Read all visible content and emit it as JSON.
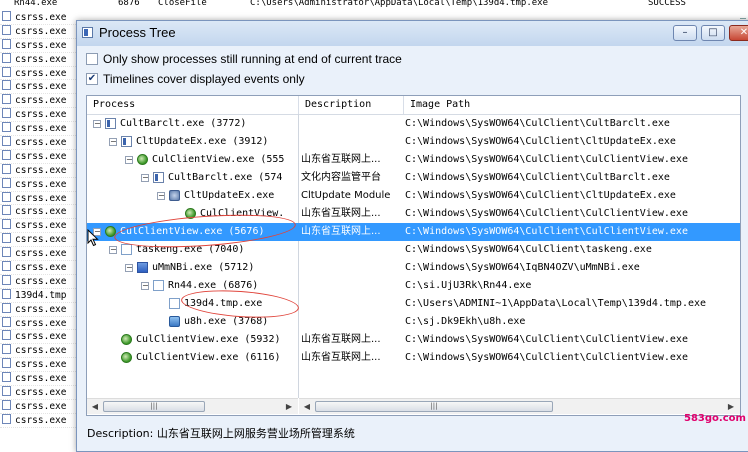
{
  "background": {
    "top_row": {
      "col1": "Rn44.exe",
      "pid": "6876",
      "operation": "CloseFile",
      "path": "C:\\Users\\Administrator\\AppData\\Local\\Temp\\139d4.tmp.exe",
      "result": "SUCCESS"
    },
    "rows": [
      "csrss.exe",
      "csrss.exe",
      "csrss.exe",
      "csrss.exe",
      "csrss.exe",
      "csrss.exe",
      "csrss.exe",
      "csrss.exe",
      "csrss.exe",
      "csrss.exe",
      "csrss.exe",
      "csrss.exe",
      "csrss.exe",
      "csrss.exe",
      "csrss.exe",
      "csrss.exe",
      "csrss.exe",
      "csrss.exe",
      "csrss.exe",
      "csrss.exe",
      "139d4.tmp",
      "csrss.exe",
      "csrss.exe",
      "csrss.exe",
      "csrss.exe",
      "csrss.exe",
      "csrss.exe",
      "csrss.exe",
      "csrss.exe",
      "csrss.exe"
    ]
  },
  "dialog": {
    "title": "Process Tree",
    "controls": {
      "minimize": "–",
      "maximize": "□",
      "close": "✕"
    },
    "options": [
      {
        "label": "Only show processes still running at end of current trace",
        "checked": false
      },
      {
        "label": "Timelines cover displayed events only",
        "checked": true
      }
    ],
    "columns": [
      "Process",
      "Description",
      "Image Path"
    ],
    "rows": [
      {
        "toggle": "−",
        "icon": "window-icon",
        "process": "CultBarclt.exe (3772)",
        "description": "",
        "path": "C:\\Windows\\SysWOW64\\CulClient\\CultBarclt.exe",
        "selected": false
      },
      {
        "toggle": "−",
        "icon": "window-icon",
        "process": "CltUpdateEx.exe (3912)",
        "description": "",
        "path": "C:\\Windows\\SysWOW64\\CulClient\\CltUpdateEx.exe",
        "selected": false
      },
      {
        "toggle": "−",
        "icon": "green-app-icon",
        "process": "CulClientView.exe (555",
        "description": "山东省互联网上...",
        "path": "C:\\Windows\\SysWOW64\\CulClient\\CulClientView.exe",
        "selected": false
      },
      {
        "toggle": "−",
        "icon": "window-icon",
        "process": "CultBarclt.exe (574",
        "description": "文化内容监管平台",
        "path": "C:\\Windows\\SysWOW64\\CulClient\\CultBarclt.exe",
        "selected": false
      },
      {
        "toggle": "−",
        "icon": "gear-icon",
        "process": "CltUpdateEx.exe",
        "description": "CltUpdate Module",
        "path": "C:\\Windows\\SysWOW64\\CulClient\\CltUpdateEx.exe",
        "selected": false
      },
      {
        "toggle": "",
        "icon": "green-app-icon",
        "process": "CulClientView.",
        "description": "山东省互联网上...",
        "path": "C:\\Windows\\SysWOW64\\CulClient\\CulClientView.exe",
        "selected": false
      },
      {
        "toggle": "−",
        "icon": "green-app-icon",
        "process": "CulClientView.exe (5676)",
        "description": "山东省互联网上...",
        "path": "C:\\Windows\\SysWOW64\\CulClient\\CulClientView.exe",
        "selected": true
      },
      {
        "toggle": "−",
        "icon": "blank-window-icon",
        "process": "taskeng.exe (7040)",
        "description": "",
        "path": "C:\\Windows\\SysWOW64\\CulClient\\taskeng.exe",
        "selected": false
      },
      {
        "toggle": "−",
        "icon": "blue-window-icon",
        "process": "uMmNBi.exe (5712)",
        "description": "",
        "path": "C:\\Windows\\SysWOW64\\IqBN4OZV\\uMmNBi.exe",
        "selected": false
      },
      {
        "toggle": "−",
        "icon": "blank-window-icon",
        "process": "Rn44.exe (6876)",
        "description": "",
        "path": "C:\\si.UjU3Rk\\Rn44.exe",
        "selected": false
      },
      {
        "toggle": "",
        "icon": "blank-window-icon",
        "process": "139d4.tmp.exe",
        "description": "",
        "path": "C:\\Users\\ADMINI~1\\AppData\\Local\\Temp\\139d4.tmp.exe",
        "selected": false
      },
      {
        "toggle": "",
        "icon": "shield-icon",
        "process": "u8h.exe (3768)",
        "description": "",
        "path": "C:\\sj.Dk9Ekh\\u8h.exe",
        "selected": false
      },
      {
        "toggle": "",
        "icon": "green-app-icon",
        "process": "CulClientView.exe (5932)",
        "description": "山东省互联网上...",
        "path": "C:\\Windows\\SysWOW64\\CulClient\\CulClientView.exe",
        "selected": false
      },
      {
        "toggle": "",
        "icon": "green-app-icon",
        "process": "CulClientView.exe (6116)",
        "description": "山东省互联网上...",
        "path": "C:\\Windows\\SysWOW64\\CulClient\\CulClientView.exe",
        "selected": false
      }
    ],
    "description_label": "Description:",
    "description_value": "山东省互联网上网服务营业场所管理系统"
  },
  "watermark": "583go.com",
  "colors": {
    "selection": "#3399ff",
    "annotation": "#e0453c",
    "watermark": "#e0006c"
  }
}
